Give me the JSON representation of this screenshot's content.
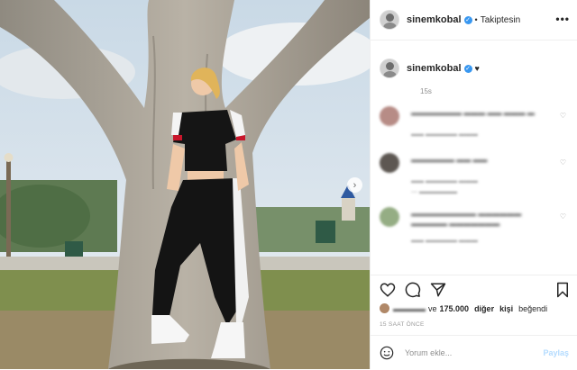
{
  "post": {
    "username": "sinemkobal",
    "verified_mark": "✓",
    "follow_status": "Takiptesin",
    "more_label": "•••",
    "caption_emoji": "♥",
    "caption_age": "15s",
    "likes": {
      "prefix": "ve",
      "count": "175.000",
      "suffix_1": "diğer",
      "suffix_2": "kişi",
      "suffix_3": "beğendi"
    },
    "posted_ago": "15 SAAT ÖNCE",
    "comment_placeholder": "Yorum ekle...",
    "share_label": "Paylaş",
    "icons": [
      "heart-icon",
      "comment-icon",
      "share-plane-icon",
      "bookmark-icon",
      "emoji-icon",
      "next-arrow-icon"
    ],
    "colors": {
      "verified": "#3897f0",
      "share_disabled": "#b3dbff",
      "meta_gray": "#8e8e8e"
    }
  }
}
